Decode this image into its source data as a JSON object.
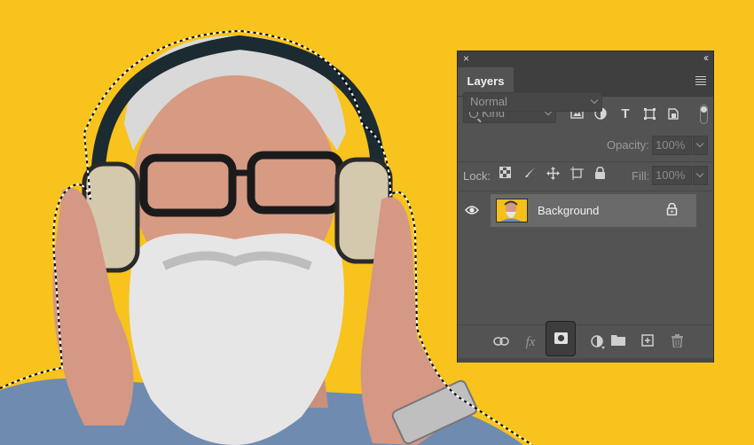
{
  "canvas": {
    "background_color": "#f7c31c",
    "subject_description_icon": "portrait-photo"
  },
  "panel": {
    "close_glyph": "×",
    "collapse_glyph": "‹‹",
    "tab_label": "Layers",
    "menu_icon": "hamburger-icon",
    "filter": {
      "kind_placeholder": "Kind",
      "icons": [
        "image-filter-icon",
        "adjustment-filter-icon",
        "type-filter-icon",
        "shape-filter-icon",
        "smart-object-filter-icon"
      ]
    },
    "blend_mode": "Normal",
    "opacity_label": "Opacity:",
    "opacity_value": "100%",
    "lock_label": "Lock:",
    "lock_icons": [
      "lock-transparent-icon",
      "lock-pixels-icon",
      "lock-position-icon",
      "lock-artboard-icon",
      "lock-all-icon"
    ],
    "fill_label": "Fill:",
    "fill_value": "100%",
    "layers": [
      {
        "name": "Background",
        "visible": true,
        "locked": true,
        "selected": true
      }
    ],
    "bottom_icons": [
      "link-layers-icon",
      "fx-icon",
      "add-mask-icon",
      "adjustment-layer-icon",
      "new-group-icon",
      "new-layer-icon",
      "delete-icon"
    ],
    "fx_label": "fx"
  }
}
